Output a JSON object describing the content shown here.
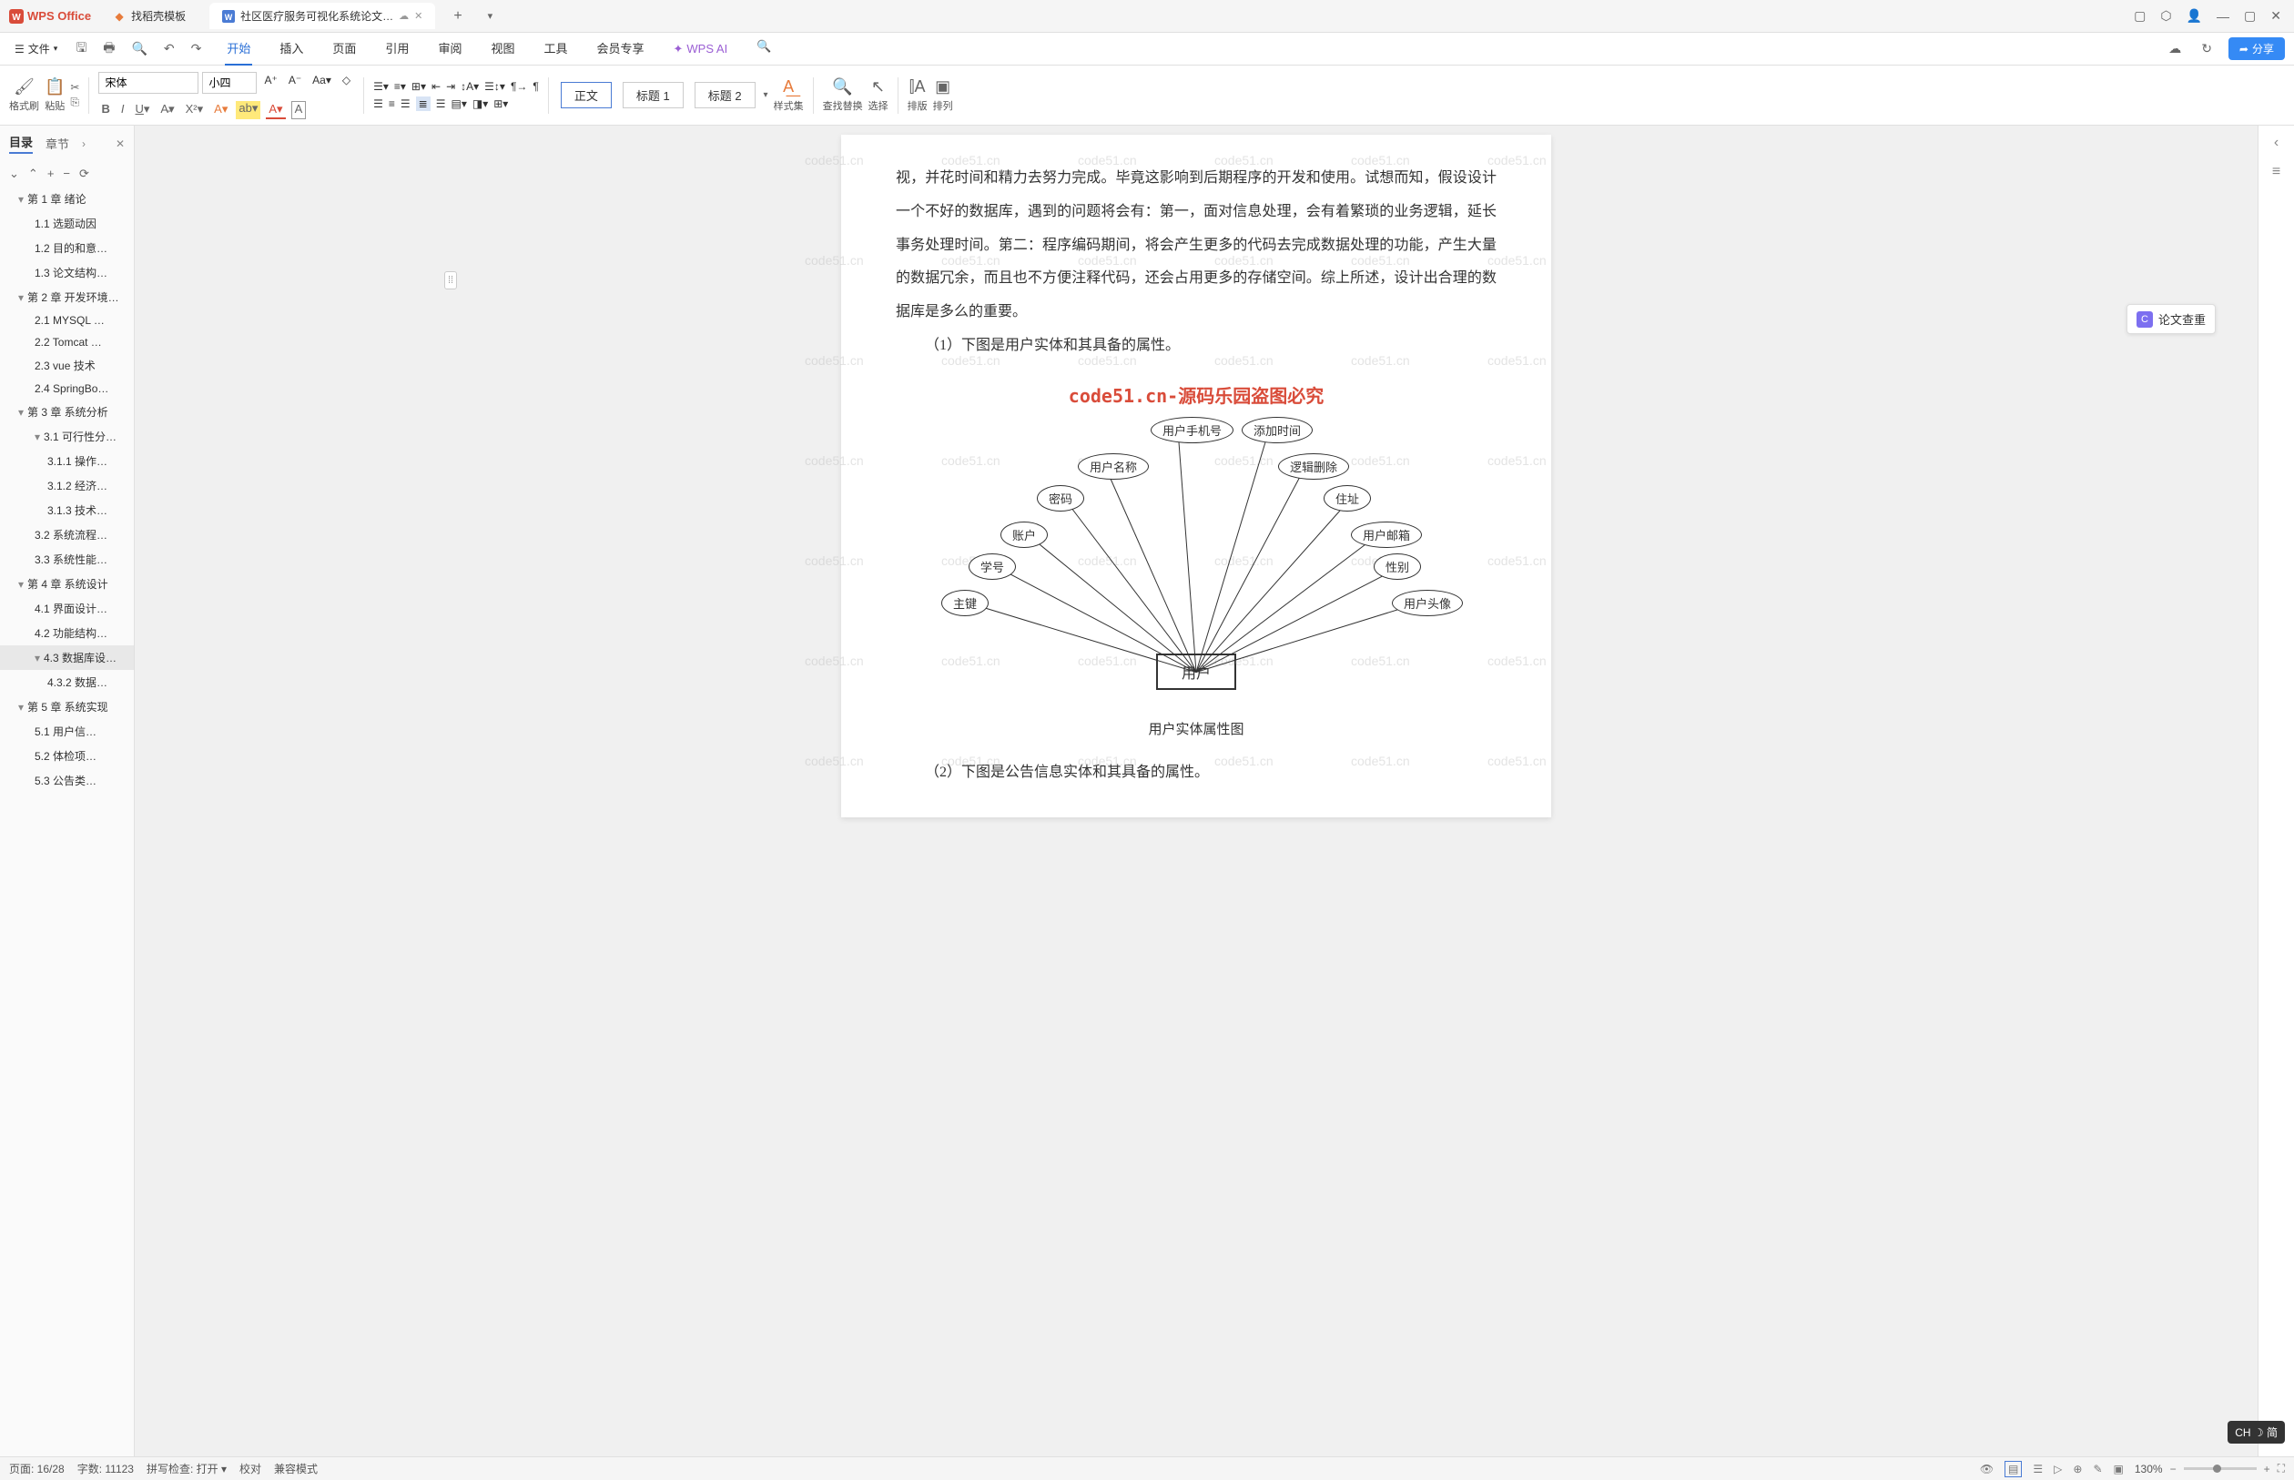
{
  "titlebar": {
    "app": "WPS Office",
    "tab1": "找稻壳模板",
    "tab2": "社区医疗服务可视化系统论文…"
  },
  "menu": {
    "file": "文件",
    "tabs": [
      "开始",
      "插入",
      "页面",
      "引用",
      "审阅",
      "视图",
      "工具",
      "会员专享"
    ],
    "ai": "WPS AI",
    "share": "分享"
  },
  "toolbar": {
    "format_brush": "格式刷",
    "paste": "粘贴",
    "font_name": "宋体",
    "font_size": "小四",
    "styles": {
      "body": "正文",
      "h1": "标题 1",
      "h2": "标题 2"
    },
    "styleset": "样式集",
    "find": "查找替换",
    "select": "选择",
    "layout": "排版",
    "arrange": "排列"
  },
  "sidebar": {
    "tab1": "目录",
    "tab2": "章节",
    "items": [
      {
        "l": 1,
        "t": "第 1 章  绪论",
        "caret": true
      },
      {
        "l": 2,
        "t": "1.1 选题动因"
      },
      {
        "l": 2,
        "t": "1.2 目的和意…"
      },
      {
        "l": 2,
        "t": "1.3 论文结构…"
      },
      {
        "l": 1,
        "t": "第 2 章  开发环境…",
        "caret": true
      },
      {
        "l": 2,
        "t": "2.1 MYSQL …"
      },
      {
        "l": 2,
        "t": "2.2 Tomcat …"
      },
      {
        "l": 2,
        "t": "2.3 vue 技术"
      },
      {
        "l": 2,
        "t": "2.4 SpringBo…"
      },
      {
        "l": 1,
        "t": "第 3 章  系统分析",
        "caret": true
      },
      {
        "l": 2,
        "t": "3.1 可行性分…",
        "caret": true
      },
      {
        "l": 3,
        "t": "3.1.1 操作…"
      },
      {
        "l": 3,
        "t": "3.1.2 经济…"
      },
      {
        "l": 3,
        "t": "3.1.3 技术…"
      },
      {
        "l": 2,
        "t": "3.2 系统流程…"
      },
      {
        "l": 2,
        "t": "3.3 系统性能…"
      },
      {
        "l": 1,
        "t": "第 4 章  系统设计",
        "caret": true
      },
      {
        "l": 2,
        "t": "4.1 界面设计…"
      },
      {
        "l": 2,
        "t": "4.2 功能结构…"
      },
      {
        "l": 2,
        "t": "4.3 数据库设…",
        "caret": true,
        "sel": true
      },
      {
        "l": 3,
        "t": "4.3.2  数据…"
      },
      {
        "l": 1,
        "t": "第 5 章  系统实现",
        "caret": true
      },
      {
        "l": 2,
        "t": "5.1 用户信…"
      },
      {
        "l": 2,
        "t": "5.2 体检项…"
      },
      {
        "l": 2,
        "t": "5.3 公告类…"
      }
    ]
  },
  "doc": {
    "p1": "视，并花时间和精力去努力完成。毕竟这影响到后期程序的开发和使用。试想而知，假设设计一个不好的数据库，遇到的问题将会有：第一，面对信息处理，会有着繁琐的业务逻辑，延长事务处理时间。第二：程序编码期间，将会产生更多的代码去完成数据处理的功能，产生大量的数据冗余，而且也不方便注释代码，还会占用更多的存储空间。综上所述，设计出合理的数据库是多么的重要。",
    "p2": "（1）下图是用户实体和其具备的属性。",
    "red": "code51.cn-源码乐园盗图必究",
    "center": "用户",
    "nodes": [
      "用户手机号",
      "添加时间",
      "用户名称",
      "逻辑删除",
      "密码",
      "住址",
      "账户",
      "用户邮箱",
      "学号",
      "性别",
      "主键",
      "用户头像"
    ],
    "caption": "用户实体属性图",
    "p3": "（2）下图是公告信息实体和其具备的属性。",
    "watermark": "code51.cn"
  },
  "rightbar": {
    "check": "论文查重"
  },
  "status": {
    "page": "页面: 16/28",
    "words": "字数: 11123",
    "spell": "拼写检查: 打开",
    "proof": "校对",
    "compat": "兼容模式",
    "zoom": "130%"
  },
  "ime": "CH ☽ 简"
}
